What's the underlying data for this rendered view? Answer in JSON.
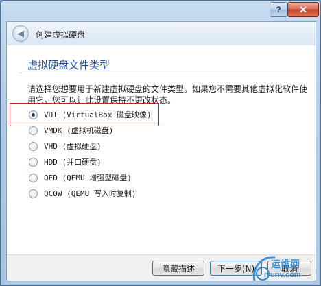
{
  "window": {
    "help_label": "?",
    "close_label": "✕"
  },
  "header": {
    "back_icon": "back-arrow-icon",
    "title": "创建虚拟硬盘"
  },
  "content": {
    "section_title": "虚拟硬盘文件类型",
    "description": "请选择您想要用于新建虚拟硬盘的文件类型。如果您不需要其他虚拟化软件使用它，您可以让此设置保持不更改状态。",
    "options": [
      {
        "label": "VDI (VirtualBox 磁盘映像)",
        "checked": true
      },
      {
        "label": "VMDK (虚拟机磁盘)",
        "checked": false
      },
      {
        "label": "VHD (虚拟硬盘)",
        "checked": false
      },
      {
        "label": "HDD (并口硬盘)",
        "checked": false
      },
      {
        "label": "QED (QEMU 增强型磁盘)",
        "checked": false
      },
      {
        "label": "QCOW (QEMU 写入时复制)",
        "checked": false
      }
    ]
  },
  "footer": {
    "hide_description_label": "隐藏描述",
    "next_label": "下一步(N)",
    "cancel_label": "取消"
  },
  "watermark": {
    "line1": "运维网",
    "line2": "iyunv.com"
  }
}
